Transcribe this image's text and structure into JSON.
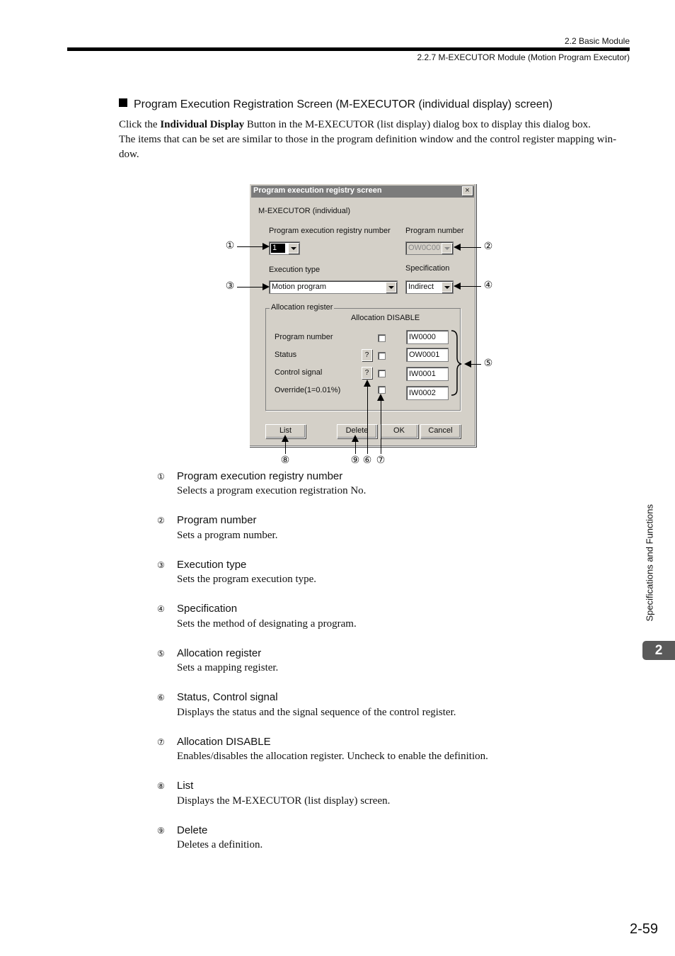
{
  "header": {
    "section": "2.2  Basic Module",
    "subsection": "2.2.7  M-EXECUTOR Module (Motion Program Executor)"
  },
  "section_title": "Program Execution Registration Screen (M-EXECUTOR (individual display) screen)",
  "intro": {
    "line1_pre": "Click the ",
    "line1_bold": "Individual Display",
    "line1_post": " Button in the M-EXECUTOR (list display) dialog box to display this dialog box.",
    "line2": "The items that can be set are similar to those in the program definition window and the control register mapping win-dow."
  },
  "dialog": {
    "title": "Program execution registry screen",
    "close": "×",
    "subtitle": "M-EXECUTOR (individual)",
    "registry_label": "Program execution registry number",
    "registry_value": "1",
    "program_number_label": "Program number",
    "program_number_value": "OW0C00",
    "execution_type_label": "Execution type",
    "execution_type_value": "Motion program",
    "specification_label": "Specification",
    "specification_value": "Indirect",
    "allocation_group_label": "Allocation register",
    "allocation_disable_header": "Allocation DISABLE",
    "rows": [
      {
        "label": "Program number",
        "register": "IW0000",
        "help": ""
      },
      {
        "label": "Status",
        "register": "OW0001",
        "help": "?"
      },
      {
        "label": "Control signal",
        "register": "IW0001",
        "help": "?"
      },
      {
        "label": "Override(1=0.01%)",
        "register": "IW0002",
        "help": ""
      }
    ],
    "buttons": {
      "list": "List",
      "delete": "Delete",
      "ok": "OK",
      "cancel": "Cancel"
    }
  },
  "callouts": {
    "c1": "①",
    "c2": "②",
    "c3": "③",
    "c4": "④",
    "c5": "⑤",
    "c6": "⑥",
    "c7": "⑦",
    "c8": "⑧",
    "c9": "⑨"
  },
  "descriptions": [
    {
      "num": "①",
      "head": "Program execution registry number",
      "text": "Selects a program execution registration No."
    },
    {
      "num": "②",
      "head": "Program number",
      "text": "Sets a program number."
    },
    {
      "num": "③",
      "head": "Execution type",
      "text": "Sets the program execution type."
    },
    {
      "num": "④",
      "head": "Specification",
      "text": "Sets the method of designating a program."
    },
    {
      "num": "⑤",
      "head": "Allocation register",
      "text": "Sets a mapping register."
    },
    {
      "num": "⑥",
      "head": "Status, Control signal",
      "text": "Displays the status and the signal sequence of the control register."
    },
    {
      "num": "⑦",
      "head": "Allocation DISABLE",
      "text": "Enables/disables the allocation register. Uncheck to enable the definition."
    },
    {
      "num": "⑧",
      "head": "List",
      "text": "Displays the M-EXECUTOR (list display) screen."
    },
    {
      "num": "⑨",
      "head": "Delete",
      "text": "Deletes a definition."
    }
  ],
  "side_tab": {
    "text": "Specifications and Functions",
    "chapter": "2"
  },
  "page_number": "2-59"
}
